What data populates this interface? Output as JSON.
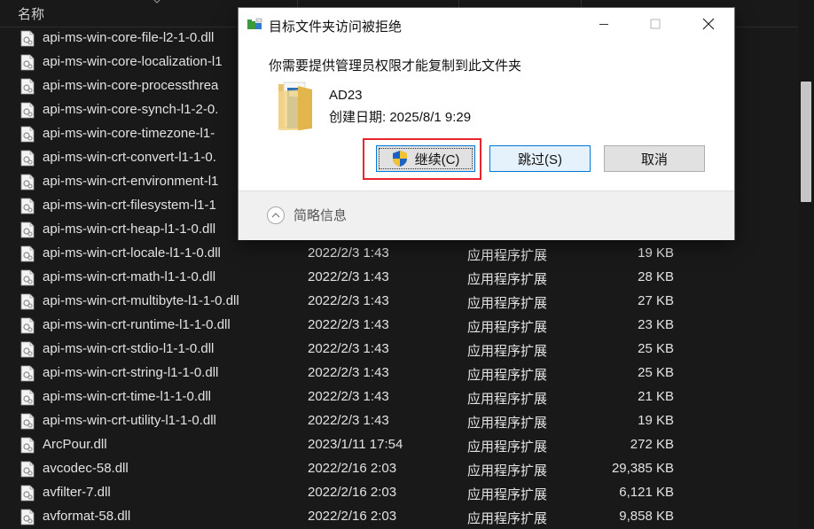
{
  "explorer": {
    "column_name_label": "名称",
    "files": [
      {
        "name": "api-ms-win-core-file-l2-1-0.dll",
        "date": "",
        "type": "",
        "size": ""
      },
      {
        "name": "api-ms-win-core-localization-l1",
        "date": "",
        "type": "",
        "size": ""
      },
      {
        "name": "api-ms-win-core-processthrea",
        "date": "",
        "type": "",
        "size": ""
      },
      {
        "name": "api-ms-win-core-synch-l1-2-0.",
        "date": "",
        "type": "",
        "size": ""
      },
      {
        "name": "api-ms-win-core-timezone-l1-",
        "date": "",
        "type": "",
        "size": ""
      },
      {
        "name": "api-ms-win-crt-convert-l1-1-0.",
        "date": "",
        "type": "",
        "size": ""
      },
      {
        "name": "api-ms-win-crt-environment-l1",
        "date": "",
        "type": "",
        "size": ""
      },
      {
        "name": "api-ms-win-crt-filesystem-l1-1",
        "date": "",
        "type": "",
        "size": ""
      },
      {
        "name": "api-ms-win-crt-heap-l1-1-0.dll",
        "date": "",
        "type": "",
        "size": ""
      },
      {
        "name": "api-ms-win-crt-locale-l1-1-0.dll",
        "date": "2022/2/3 1:43",
        "type": "应用程序扩展",
        "size": "19 KB"
      },
      {
        "name": "api-ms-win-crt-math-l1-1-0.dll",
        "date": "2022/2/3 1:43",
        "type": "应用程序扩展",
        "size": "28 KB"
      },
      {
        "name": "api-ms-win-crt-multibyte-l1-1-0.dll",
        "date": "2022/2/3 1:43",
        "type": "应用程序扩展",
        "size": "27 KB"
      },
      {
        "name": "api-ms-win-crt-runtime-l1-1-0.dll",
        "date": "2022/2/3 1:43",
        "type": "应用程序扩展",
        "size": "23 KB"
      },
      {
        "name": "api-ms-win-crt-stdio-l1-1-0.dll",
        "date": "2022/2/3 1:43",
        "type": "应用程序扩展",
        "size": "25 KB"
      },
      {
        "name": "api-ms-win-crt-string-l1-1-0.dll",
        "date": "2022/2/3 1:43",
        "type": "应用程序扩展",
        "size": "25 KB"
      },
      {
        "name": "api-ms-win-crt-time-l1-1-0.dll",
        "date": "2022/2/3 1:43",
        "type": "应用程序扩展",
        "size": "21 KB"
      },
      {
        "name": "api-ms-win-crt-utility-l1-1-0.dll",
        "date": "2022/2/3 1:43",
        "type": "应用程序扩展",
        "size": "19 KB"
      },
      {
        "name": "ArcPour.dll",
        "date": "2023/1/11 17:54",
        "type": "应用程序扩展",
        "size": "272 KB"
      },
      {
        "name": "avcodec-58.dll",
        "date": "2022/2/16 2:03",
        "type": "应用程序扩展",
        "size": "29,385 KB"
      },
      {
        "name": "avfilter-7.dll",
        "date": "2022/2/16 2:03",
        "type": "应用程序扩展",
        "size": "6,121 KB"
      },
      {
        "name": "avformat-58.dll",
        "date": "2022/2/16 2:03",
        "type": "应用程序扩展",
        "size": "9,858 KB"
      }
    ]
  },
  "dialog": {
    "title": "目标文件夹访问被拒绝",
    "message": "你需要提供管理员权限才能复制到此文件夹",
    "item_name": "AD23",
    "item_created": "创建日期: 2025/8/1 9:29",
    "buttons": {
      "continue": "继续(C)",
      "skip": "跳过(S)",
      "cancel": "取消"
    },
    "details_label": "简略信息",
    "highlight_color": "#e8242c",
    "accent_color": "#0078d7",
    "icons": [
      "folder-access-icon",
      "minimize-icon",
      "maximize-icon",
      "close-icon",
      "folder-icon",
      "uac-shield-icon",
      "chevron-up-icon"
    ]
  }
}
